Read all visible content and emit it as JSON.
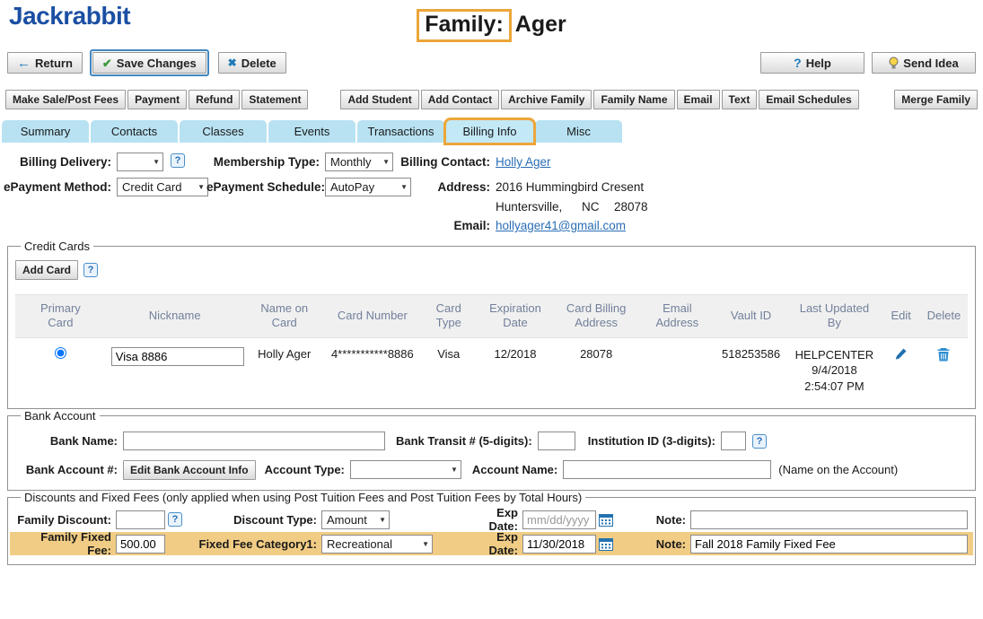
{
  "logo": "Jackrabbit",
  "title": {
    "prefix": "Family:",
    "name": "Ager"
  },
  "icons": {
    "return_arrow": "←",
    "save_check": "✔",
    "delete_x": "✖",
    "help_q": "?",
    "select_arrow": "▼"
  },
  "toolbar": {
    "return": "Return",
    "save": "Save Changes",
    "delete": "Delete",
    "help": "Help",
    "send_idea": "Send Idea"
  },
  "actions": [
    "Make Sale/Post Fees",
    "Payment",
    "Refund",
    "Statement",
    "Add Student",
    "Add Contact",
    "Archive Family",
    "Family Name",
    "Email",
    "Text",
    "Email Schedules",
    "Merge Family"
  ],
  "tabs": [
    "Summary",
    "Contacts",
    "Classes",
    "Events",
    "Transactions",
    "Billing Info",
    "Misc"
  ],
  "active_tab": "Billing Info",
  "billing": {
    "billing_delivery_label": "Billing Delivery:",
    "billing_delivery_value": "",
    "membership_type_label": "Membership Type:",
    "membership_type_value": "Monthly",
    "billing_contact_label": "Billing Contact:",
    "billing_contact_value": "Holly Ager",
    "epayment_method_label": "ePayment Method:",
    "epayment_method_value": "Credit Card",
    "epayment_schedule_label": "ePayment Schedule:",
    "epayment_schedule_value": "AutoPay",
    "address_label": "Address:",
    "address_line1": "2016 Hummingbird Cresent",
    "address_city": "Huntersville,",
    "address_state": "NC",
    "address_zip": "28078",
    "email_label": "Email:",
    "email_value": "hollyager41@gmail.com"
  },
  "credit_cards": {
    "legend": "Credit Cards",
    "add_card": "Add Card",
    "headers": [
      "Primary Card",
      "Nickname",
      "Name on Card",
      "Card Number",
      "Card Type",
      "Expiration Date",
      "Card Billing Address",
      "Email Address",
      "Vault ID",
      "Last Updated By",
      "Edit",
      "Delete"
    ],
    "row": {
      "nickname": "Visa 8886",
      "name_on_card": "Holly Ager",
      "card_number": "4***********8886",
      "card_type": "Visa",
      "expiration": "12/2018",
      "billing_address": "28078",
      "email_address": "",
      "vault_id": "518253586",
      "updated_by": "HELPCENTER",
      "updated_date": "9/4/2018",
      "updated_time": "2:54:07 PM"
    }
  },
  "bank": {
    "legend": "Bank Account",
    "bank_name_label": "Bank Name:",
    "transit_label": "Bank Transit # (5-digits):",
    "institution_label": "Institution ID (3-digits):",
    "account_number_label": "Bank Account #:",
    "edit_bank_button": "Edit Bank Account Info",
    "account_type_label": "Account Type:",
    "account_type_value": "",
    "account_name_label": "Account Name:",
    "account_name_hint": "(Name on the Account)"
  },
  "discounts": {
    "legend": "Discounts and Fixed Fees (only applied when using Post Tuition Fees and Post Tuition Fees by Total Hours)",
    "family_discount_label": "Family Discount:",
    "discount_type_label": "Discount Type:",
    "discount_type_value": "Amount",
    "exp_date_label": "Exp Date:",
    "exp_date_placeholder": "mm/dd/yyyy",
    "note_label": "Note:",
    "fixed_fee_label": "Family Fixed Fee:",
    "fixed_fee_value": "500.00",
    "fixed_category_label": "Fixed Fee Category1:",
    "fixed_category_value": "Recreational",
    "fixed_exp_date_label": "Exp Date:",
    "fixed_exp_date_value": "11/30/2018",
    "fixed_note_label": "Note:",
    "fixed_note_value": "Fall 2018 Family Fixed Fee"
  },
  "colors": {
    "annotation_orange": "#eca63a",
    "annotation_blue": "#4187c0",
    "tab_blue": "#b8e2f2",
    "link_blue": "#2a6db5",
    "highlight_row": "#f1cc84"
  }
}
